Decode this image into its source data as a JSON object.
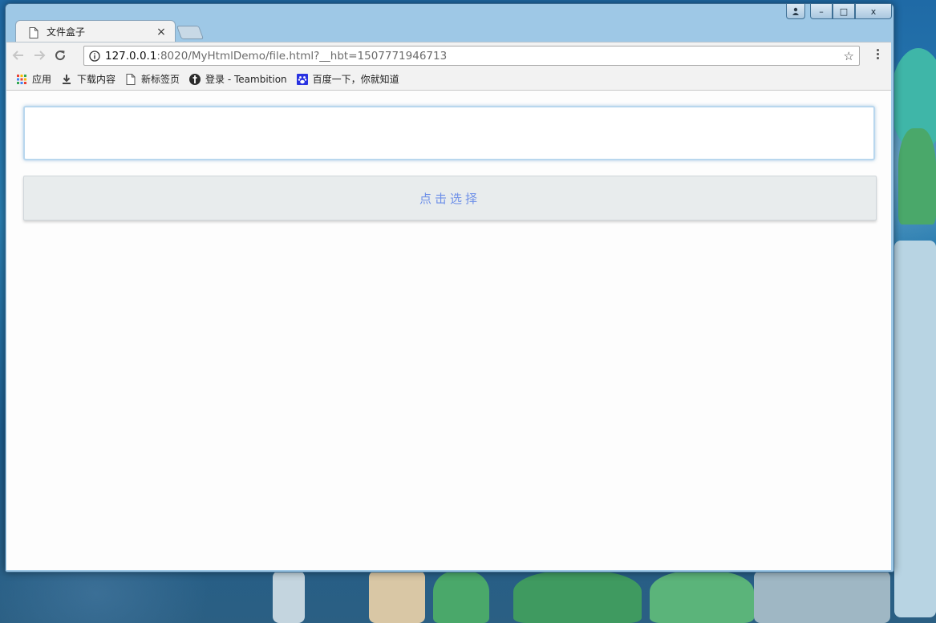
{
  "browser": {
    "tab": {
      "title": "文件盒子",
      "close_glyph": "×",
      "icon": "document-icon"
    },
    "toolbar": {
      "url_host": "127.0.0.1",
      "url_rest": ":8020/MyHtmlDemo/file.html?__hbt=1507771946713",
      "back_icon": "back-arrow-icon",
      "forward_icon": "forward-arrow-icon",
      "reload_icon": "reload-icon",
      "info_icon": "info-icon",
      "star_glyph": "☆",
      "menu_icon": "more-vert-icon"
    },
    "bookmarks": [
      {
        "label": "应用",
        "icon": "apps-grid-icon"
      },
      {
        "label": "下载内容",
        "icon": "download-icon"
      },
      {
        "label": "新标签页",
        "icon": "document-icon"
      },
      {
        "label": "登录 - Teambition",
        "icon": "teambition-icon"
      },
      {
        "label": "百度一下，你就知道",
        "icon": "baidu-paw-icon"
      }
    ],
    "window_controls": {
      "minimize_glyph": "–",
      "maximize_glyph": "□",
      "close_glyph": "x"
    }
  },
  "page": {
    "input_value": "",
    "select_button_label": "点击选择",
    "select_button_color": "#6e90e8",
    "input_border_color": "#b9d7ee"
  }
}
